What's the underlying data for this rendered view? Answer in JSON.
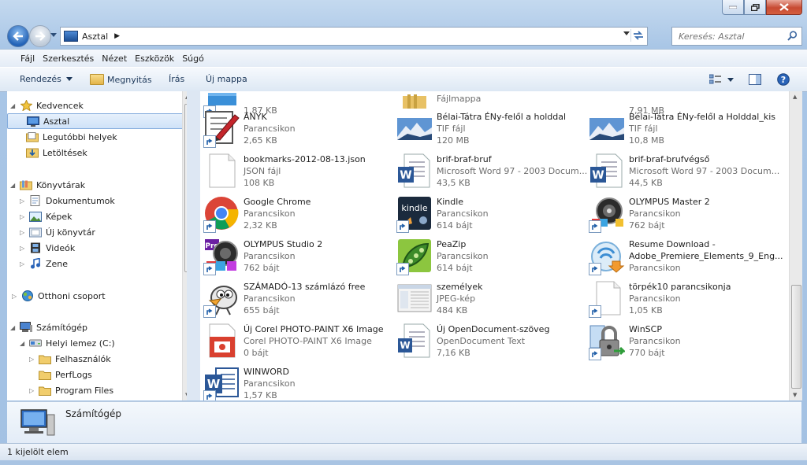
{
  "window": {
    "address": "Asztal",
    "search_placeholder": "Keresés: Asztal"
  },
  "menu": [
    "Fájl",
    "Szerkesztés",
    "Nézet",
    "Eszközök",
    "Súgó"
  ],
  "commands": {
    "organize": "Rendezés",
    "open": "Megnyitás",
    "burn": "Írás",
    "new_folder": "Új mappa"
  },
  "nav": {
    "favorites": "Kedvencek",
    "desktop": "Asztal",
    "recent": "Legutóbbi helyek",
    "downloads": "Letöltések",
    "libraries": "Könyvtárak",
    "documents": "Dokumentumok",
    "pictures": "Képek",
    "new_library": "Új könyvtár",
    "videos": "Videók",
    "music": "Zene",
    "homegroup": "Otthoni csoport",
    "computer": "Számítógép",
    "local_disk": "Helyi lemez (C:)",
    "users": "Felhasználók",
    "perflogs": "PerfLogs",
    "program_files": "Program Files"
  },
  "files": [
    {
      "name": "",
      "type": "",
      "size": "1,87 KB",
      "icon": "blue-app-icon"
    },
    {
      "name": "",
      "type": "Fájlmappa",
      "size": "",
      "icon": "folder-icon"
    },
    {
      "name": "",
      "type": "",
      "size": "7,91 MB",
      "icon": ""
    },
    {
      "name": "ÁNYK",
      "type": "Parancsikon",
      "size": "2,65 KB",
      "icon": "anyk-pen-icon"
    },
    {
      "name": "Bélai-Tátra ÉNy-felől a holddal",
      "type": "TIF fájl",
      "size": "120 MB",
      "icon": "mountain-photo-icon"
    },
    {
      "name": "Bélai-Tátra ÉNy-felől a Holddal_kis",
      "type": "TIF fájl",
      "size": "10,8 MB",
      "icon": "mountain-photo-icon"
    },
    {
      "name": "bookmarks-2012-08-13.json",
      "type": "JSON fájl",
      "size": "108 KB",
      "icon": "blank-document-icon"
    },
    {
      "name": "brif-braf-bruf",
      "type": "Microsoft Word 97 - 2003 Docum...",
      "size": "43,5 KB",
      "icon": "word-document-icon"
    },
    {
      "name": "brif-braf-brufvégső",
      "type": "Microsoft Word 97 - 2003 Docum...",
      "size": "44,5 KB",
      "icon": "word-document-icon"
    },
    {
      "name": "Google Chrome",
      "type": "Parancsikon",
      "size": "2,32 KB",
      "icon": "chrome-icon"
    },
    {
      "name": "Kindle",
      "type": "Parancsikon",
      "size": "614 bájt",
      "icon": "kindle-icon"
    },
    {
      "name": "OLYMPUS Master 2",
      "type": "Parancsikon",
      "size": "762 bájt",
      "icon": "olympus-icon"
    },
    {
      "name": "OLYMPUS Studio 2",
      "type": "Parancsikon",
      "size": "762 bájt",
      "icon": "olympus-studio-icon"
    },
    {
      "name": "PeaZip",
      "type": "Parancsikon",
      "size": "614 bájt",
      "icon": "peazip-icon"
    },
    {
      "name": "Resume Download -",
      "name2": "Adobe_Premiere_Elements_9_Eng...",
      "type": "Parancsikon",
      "size": "",
      "icon": "resume-download-icon"
    },
    {
      "name": "SZÁMADÓ-13 számlázó free",
      "type": "Parancsikon",
      "size": "655 bájt",
      "icon": "cartoon-bird-icon"
    },
    {
      "name": "személyek",
      "type": "JPEG-kép",
      "size": "484 KB",
      "icon": "jpeg-thumbnail-icon"
    },
    {
      "name": "törpék10 parancsikonja",
      "type": "Parancsikon",
      "size": "1,05 KB",
      "icon": "blank-document-icon"
    },
    {
      "name": "Új Corel PHOTO-PAINT X6 Image",
      "type": "Corel PHOTO-PAINT X6 Image",
      "size": "0 bájt",
      "icon": "corel-image-icon"
    },
    {
      "name": "Új OpenDocument-szöveg",
      "type": "OpenDocument Text",
      "size": "7,16 KB",
      "icon": "odt-document-icon"
    },
    {
      "name": "WinSCP",
      "type": "Parancsikon",
      "size": "770 bájt",
      "icon": "winscp-icon"
    },
    {
      "name": "WINWORD",
      "type": "Parancsikon",
      "size": "1,57 KB",
      "icon": "word-icon"
    }
  ],
  "details": {
    "name": "Számítógép"
  },
  "status": {
    "text": "1 kijelölt elem"
  },
  "colors": {
    "accent": "#1f5ea8",
    "selection": "#cfe2f8"
  }
}
